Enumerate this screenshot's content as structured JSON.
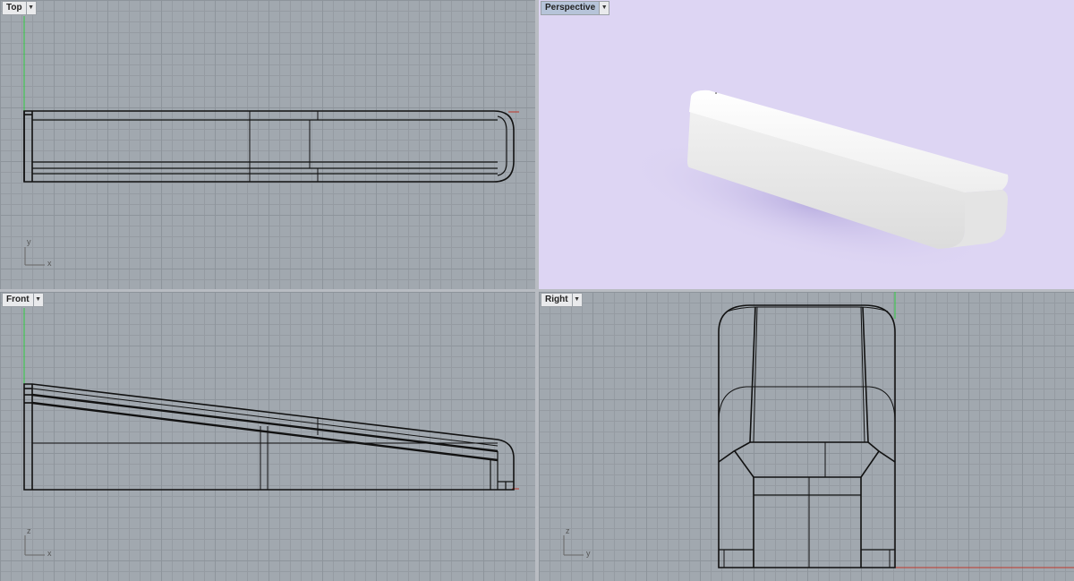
{
  "viewports": {
    "top": {
      "title": "Top",
      "axis_h": "x",
      "axis_v": "y"
    },
    "perspective": {
      "title": "Perspective"
    },
    "front": {
      "title": "Front",
      "axis_h": "x",
      "axis_v": "z"
    },
    "right": {
      "title": "Right",
      "axis_h": "y",
      "axis_v": "z"
    }
  },
  "colors": {
    "grid_bg": "#a1a8af",
    "perspective_bg": "#ddd5f3",
    "x_axis": "#c0392b",
    "y_axis": "#2ecc40",
    "wireframe": "#111111",
    "active_label": "#b6c4d9"
  },
  "icons": {
    "dropdown": "chevron-down-icon"
  }
}
